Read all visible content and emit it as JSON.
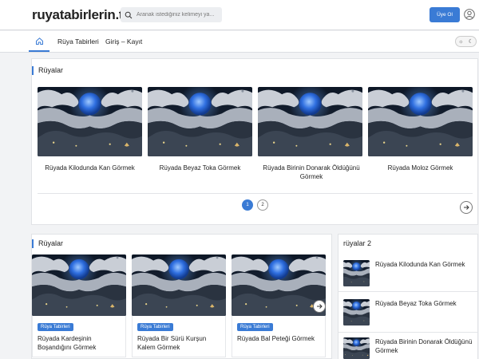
{
  "header": {
    "logo": "ruyatabirlerin.tr",
    "search_placeholder": "Aranak istediğiniz kelimeyi ya...",
    "signup_label": "Üye Ol"
  },
  "nav": {
    "links": [
      "Rüya Tabirleri",
      "Giriş – Kayıt"
    ]
  },
  "top_section": {
    "title": "Rüyalar",
    "items": [
      {
        "caption": "Rüyada Kilodunda Kan Görmek"
      },
      {
        "caption": "Rüyada Beyaz Toka Görmek"
      },
      {
        "caption": "Rüyada Birinin Donarak Öldüğünü Görmek"
      },
      {
        "caption": "Rüyada Moloz Görmek"
      }
    ],
    "pages": [
      "1",
      "2"
    ]
  },
  "bottom_section": {
    "title": "Rüyalar",
    "items": [
      {
        "badge": "Rüya Tabirleri",
        "caption": "Rüyada Kardeşinin Boşandığını Görmek"
      },
      {
        "badge": "Rüya Tabirleri",
        "caption": "Rüyada Bir Sürü Kurşun Kalem Görmek"
      },
      {
        "badge": "Rüya Tabirleri",
        "caption": "Rüyada Bal Peteği Görmek"
      }
    ]
  },
  "sidebar": {
    "title": "rüyalar 2",
    "items": [
      {
        "caption": "Rüyada Kilodunda Kan Görmek"
      },
      {
        "caption": "Rüyada Beyaz Toka Görmek"
      },
      {
        "caption": "Rüyada Birinin Donarak Öldüğünü Görmek"
      }
    ]
  },
  "colors": {
    "accent": "#3a7bd5",
    "background": "#f2f3f5"
  },
  "icons": [
    "search-icon",
    "user-icon",
    "home-icon",
    "sun-icon",
    "moon-icon",
    "chevron-right-icon"
  ]
}
